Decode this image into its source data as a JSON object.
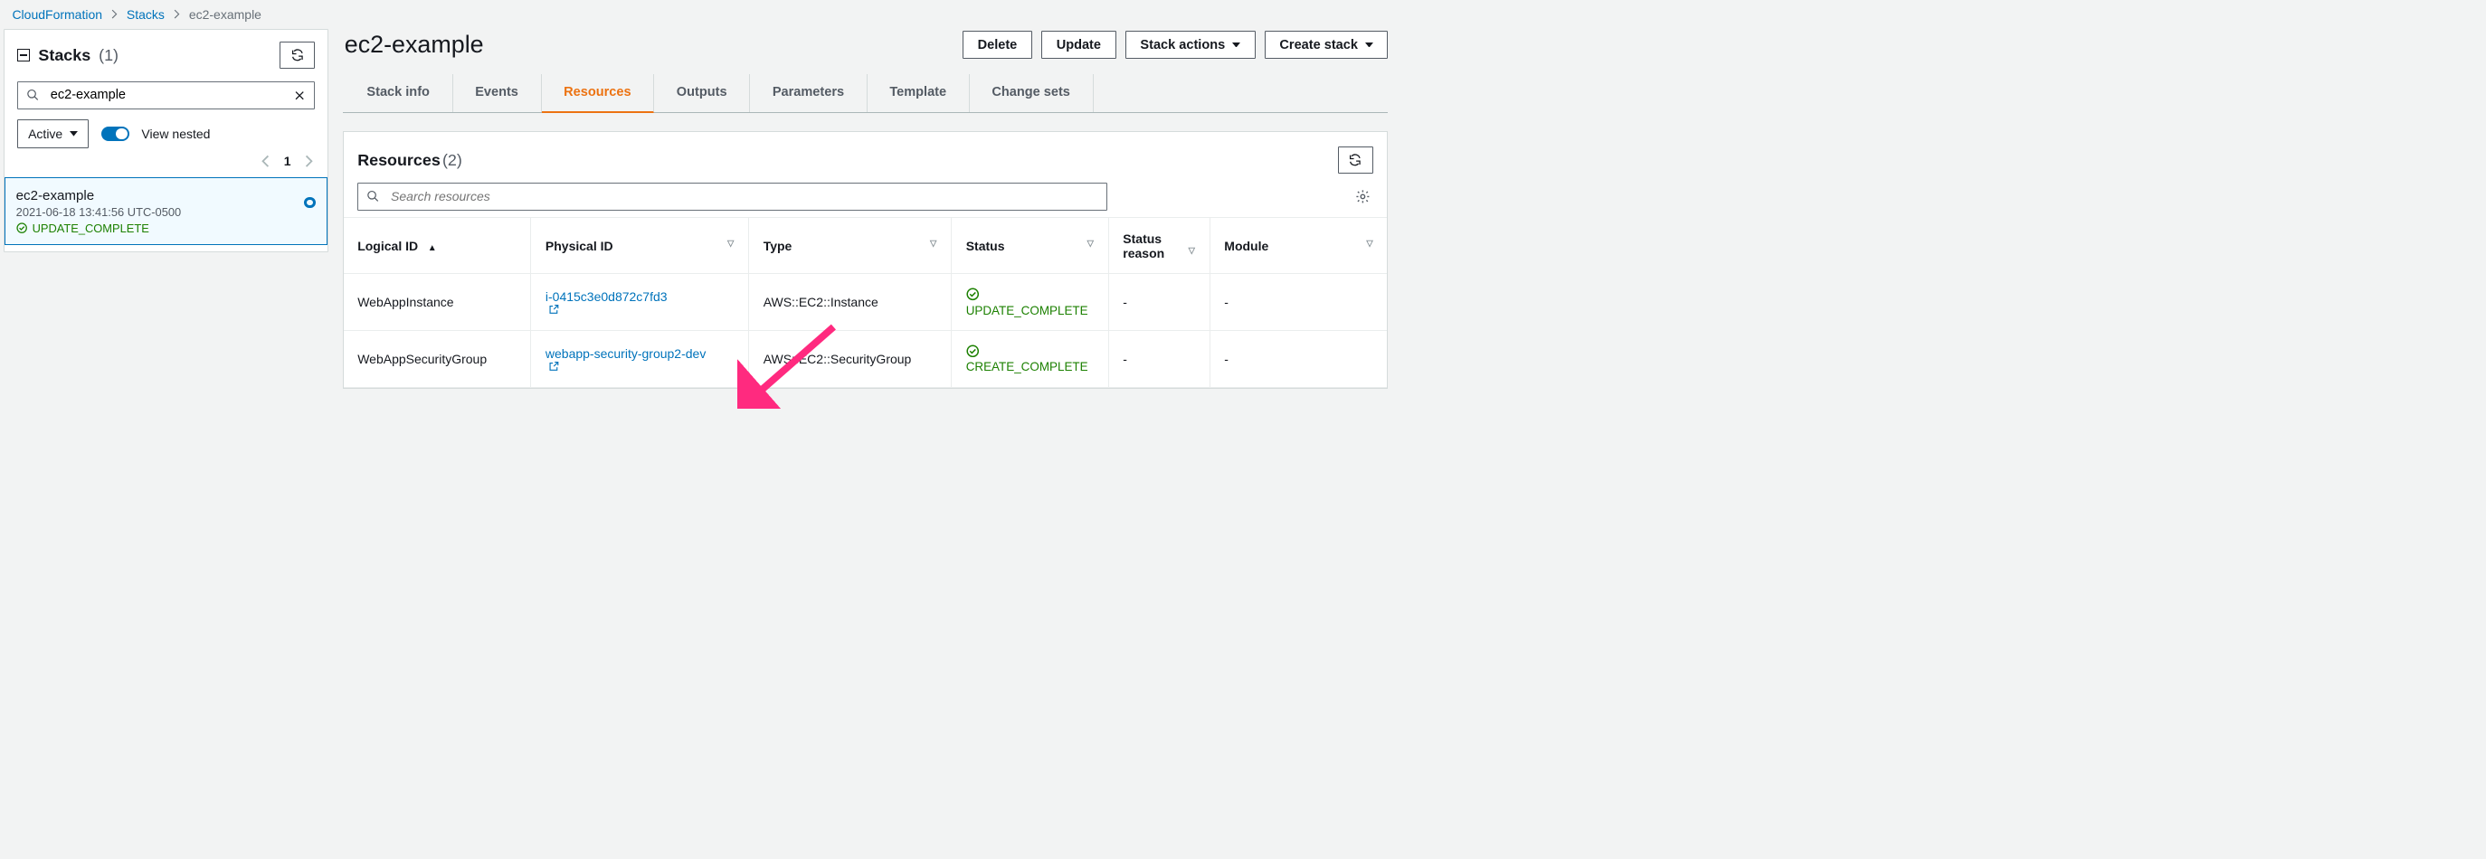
{
  "breadcrumb": {
    "items": [
      {
        "label": "CloudFormation",
        "href": true
      },
      {
        "label": "Stacks",
        "href": true
      },
      {
        "label": "ec2-example",
        "href": false
      }
    ]
  },
  "sidebar": {
    "title": "Stacks",
    "count": "(1)",
    "search_value": "ec2-example",
    "filter_select": "Active",
    "view_nested_label": "View nested",
    "page_number": "1",
    "stack": {
      "name": "ec2-example",
      "time": "2021-06-18 13:41:56 UTC-0500",
      "status": "UPDATE_COMPLETE"
    }
  },
  "main": {
    "title": "ec2-example",
    "buttons": {
      "delete": "Delete",
      "update": "Update",
      "stack_actions": "Stack actions",
      "create_stack": "Create stack"
    }
  },
  "tabs": [
    {
      "label": "Stack info",
      "active": false
    },
    {
      "label": "Events",
      "active": false
    },
    {
      "label": "Resources",
      "active": true
    },
    {
      "label": "Outputs",
      "active": false
    },
    {
      "label": "Parameters",
      "active": false
    },
    {
      "label": "Template",
      "active": false
    },
    {
      "label": "Change sets",
      "active": false
    }
  ],
  "resources_panel": {
    "title": "Resources",
    "count": "(2)",
    "search_placeholder": "Search resources",
    "columns": [
      "Logical ID",
      "Physical ID",
      "Type",
      "Status",
      "Status reason",
      "Module"
    ],
    "rows": [
      {
        "logical_id": "WebAppInstance",
        "physical_id": "i-0415c3e0d872c7fd3",
        "type": "AWS::EC2::Instance",
        "status": "UPDATE_COMPLETE",
        "status_reason": "-",
        "module": "-"
      },
      {
        "logical_id": "WebAppSecurityGroup",
        "physical_id": "webapp-security-group2-dev",
        "type": "AWS::EC2::SecurityGroup",
        "status": "CREATE_COMPLETE",
        "status_reason": "-",
        "module": "-"
      }
    ]
  }
}
